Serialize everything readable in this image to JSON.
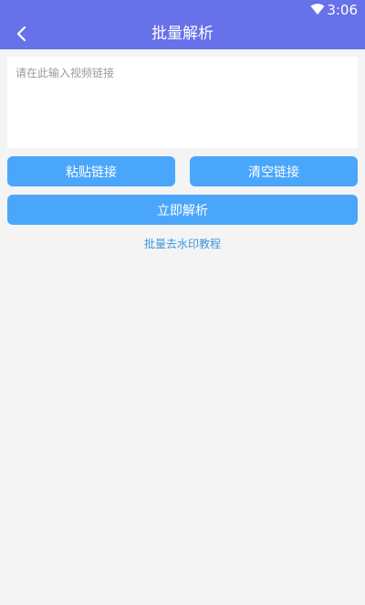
{
  "status_bar": {
    "time": "3:06",
    "wifi_icon": "wifi-icon"
  },
  "header": {
    "title": "批量解析",
    "back_icon": "chevron-left-icon",
    "background_color": "#6771ea"
  },
  "input": {
    "placeholder": "请在此输入视频链接",
    "value": ""
  },
  "buttons": {
    "paste_label": "粘贴链接",
    "clear_label": "清空链接",
    "parse_label": "立即解析",
    "color": "#4aa6fb"
  },
  "tutorial_link": {
    "label": "批量去水印教程",
    "color": "#3e97d8"
  }
}
